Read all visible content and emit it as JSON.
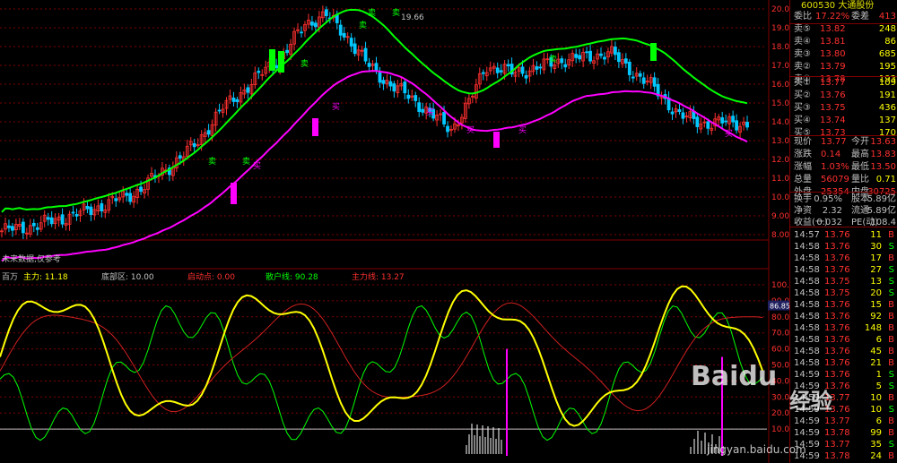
{
  "colors": {
    "up": "#ff3030",
    "down": "#00c8ff",
    "green": "#00ff00",
    "magenta": "#ff00ff",
    "yellow": "#ffff00",
    "grid": "#800000",
    "axis": "#ff3030"
  },
  "header": {
    "stock_code": "600530 大通股份"
  },
  "price_axis": [
    "20.00",
    "19.00",
    "18.00",
    "17.00",
    "16.00",
    "15.00",
    "14.00",
    "13.00",
    "12.00",
    "11.00",
    "10.00",
    "9.00",
    "8.00"
  ],
  "osc_axis": [
    "100.0",
    "90.00",
    "80.00",
    "70.00",
    "60.00",
    "50.00",
    "40.00",
    "30.00",
    "20.00",
    "10.00"
  ],
  "osc_current_value": "86.85",
  "high_label": "19.66",
  "disclaimer": "未来数据,仅参考",
  "indicator_line": [
    {
      "text": "百万",
      "color": "#c0c0c0"
    },
    {
      "text": "主力: 11.18",
      "color": "#ffff00"
    },
    {
      "text": "底部区: 10.00",
      "color": "#c0c0c0"
    },
    {
      "text": "启动点: 0.00",
      "color": "#ff3030"
    },
    {
      "text": "散户线: 90.28",
      "color": "#00ff00"
    },
    {
      "text": "主力线: 13.27",
      "color": "#ff3030"
    }
  ],
  "buy_sell_markers": [
    {
      "text": "卖",
      "color": "#00ff00"
    },
    {
      "text": "卖",
      "color": "#00ff00"
    },
    {
      "text": "卖",
      "color": "#00ff00"
    },
    {
      "text": "卖",
      "color": "#00ff00"
    },
    {
      "text": "卖",
      "color": "#00ff00"
    },
    {
      "text": "卖",
      "color": "#00ff00"
    },
    {
      "text": "卖",
      "color": "#00ff00"
    },
    {
      "text": "买",
      "color": "#ff00ff"
    },
    {
      "text": "买",
      "color": "#ff00ff"
    },
    {
      "text": "买",
      "color": "#ff00ff"
    },
    {
      "text": "买",
      "color": "#ff00ff"
    },
    {
      "text": "买",
      "color": "#ff00ff"
    },
    {
      "text": "买",
      "color": "#ff00ff"
    }
  ],
  "quote": {
    "weibi_label": "委比",
    "weibi_value": "17.22%",
    "weicha_label": "委差",
    "weicha_value": "413",
    "sell": [
      {
        "label": "卖⑤",
        "price": "13.82",
        "vol": "248"
      },
      {
        "label": "卖④",
        "price": "13.81",
        "vol": "86"
      },
      {
        "label": "卖③",
        "price": "13.80",
        "vol": "685"
      },
      {
        "label": "卖②",
        "price": "13.79",
        "vol": "195"
      },
      {
        "label": "卖①",
        "price": "13.78",
        "vol": "193"
      }
    ],
    "buy": [
      {
        "label": "买①",
        "price": "13.77",
        "vol": "109"
      },
      {
        "label": "买②",
        "price": "13.76",
        "vol": "191"
      },
      {
        "label": "买③",
        "price": "13.75",
        "vol": "436"
      },
      {
        "label": "买④",
        "price": "13.74",
        "vol": "137"
      },
      {
        "label": "买⑤",
        "price": "13.73",
        "vol": "170"
      }
    ],
    "stats": [
      {
        "l1": "现价",
        "v1": "13.77",
        "l2": "今开",
        "v2": "13.63"
      },
      {
        "l1": "涨跌",
        "v1": "0.14",
        "l2": "最高",
        "v2": "13.83"
      },
      {
        "l1": "涨幅",
        "v1": "1.03%",
        "l2": "最低",
        "v2": "13.50"
      },
      {
        "l1": "总量",
        "v1": "56079",
        "l2": "量比",
        "v2": "0.71"
      },
      {
        "l1": "外盘",
        "v1": "25354",
        "l2": "内盘",
        "v2": "30725"
      }
    ],
    "stats2": [
      {
        "l1": "换手",
        "v1": "0.95%",
        "l2": "股本",
        "v2": "5.89亿"
      },
      {
        "l1": "净资",
        "v1": "2.32",
        "l2": "流通",
        "v2": "5.89亿"
      },
      {
        "l1": "收益(一)",
        "v1": "0.032",
        "l2": "PE(动)",
        "v2": "108.4"
      }
    ]
  },
  "ticks": [
    {
      "t": "14:57",
      "p": "13.76",
      "v": "11",
      "d": "B"
    },
    {
      "t": "14:58",
      "p": "13.76",
      "v": "30",
      "d": "S"
    },
    {
      "t": "14:58",
      "p": "13.76",
      "v": "17",
      "d": "B"
    },
    {
      "t": "14:58",
      "p": "13.76",
      "v": "27",
      "d": "S"
    },
    {
      "t": "14:58",
      "p": "13.75",
      "v": "13",
      "d": "S"
    },
    {
      "t": "14:58",
      "p": "13.75",
      "v": "20",
      "d": "S"
    },
    {
      "t": "14:58",
      "p": "13.76",
      "v": "15",
      "d": "B"
    },
    {
      "t": "14:58",
      "p": "13.76",
      "v": "92",
      "d": "B"
    },
    {
      "t": "14:58",
      "p": "13.76",
      "v": "148",
      "d": "B"
    },
    {
      "t": "14:58",
      "p": "13.76",
      "v": "6",
      "d": "B"
    },
    {
      "t": "14:58",
      "p": "13.76",
      "v": "45",
      "d": "B"
    },
    {
      "t": "14:58",
      "p": "13.76",
      "v": "21",
      "d": "B"
    },
    {
      "t": "14:59",
      "p": "13.76",
      "v": "1",
      "d": "S"
    },
    {
      "t": "14:59",
      "p": "13.76",
      "v": "5",
      "d": "S"
    },
    {
      "t": "14:59",
      "p": "13.77",
      "v": "10",
      "d": "B"
    },
    {
      "t": "14:59",
      "p": "13.76",
      "v": "10",
      "d": "S"
    },
    {
      "t": "14:59",
      "p": "13.77",
      "v": "6",
      "d": "B"
    },
    {
      "t": "14:59",
      "p": "13.78",
      "v": "99",
      "d": "B"
    },
    {
      "t": "14:59",
      "p": "13.77",
      "v": "35",
      "d": "S"
    },
    {
      "t": "14:59",
      "p": "13.78",
      "v": "24",
      "d": "B"
    }
  ],
  "watermark": {
    "brand": "Baidu",
    "cn": "经验",
    "url": "jingyan.baidu.com"
  }
}
